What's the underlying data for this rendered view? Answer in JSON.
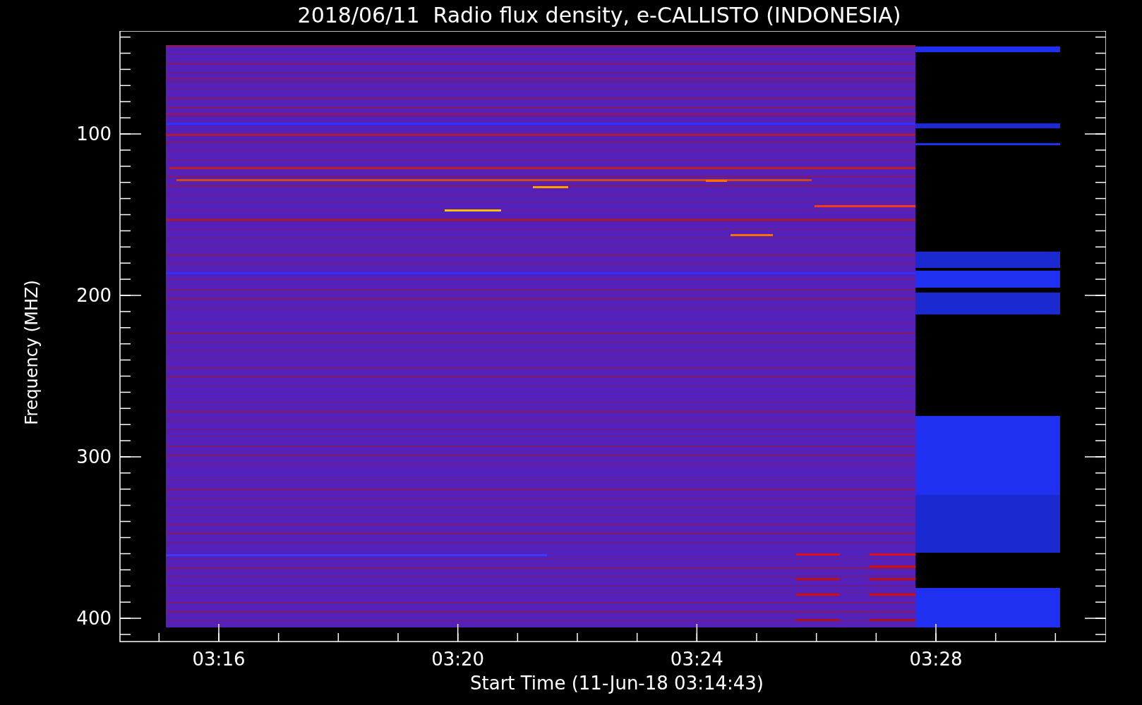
{
  "title": "2018/06/11  Radio flux density, e-CALLISTO (INDONESIA)",
  "ylabel": "Frequency (MHZ)",
  "xlabel": "Start Time (11-Jun-18 03:14:43)",
  "yticks": [
    "100",
    "200",
    "300",
    "400"
  ],
  "xticks": [
    "03:16",
    "03:20",
    "03:24",
    "03:28"
  ]
}
